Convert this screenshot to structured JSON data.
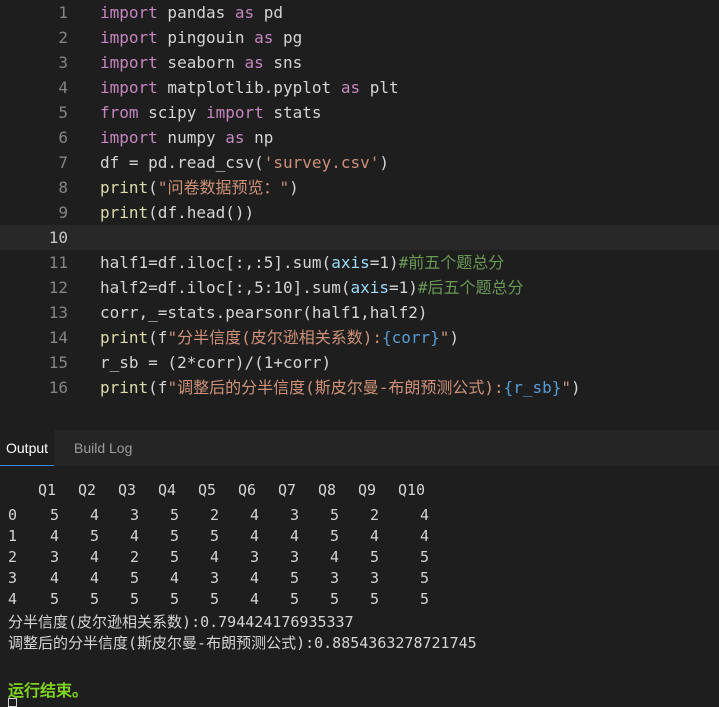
{
  "editor": {
    "lines": [
      {
        "n": "1",
        "tokens": [
          [
            "kw",
            "import"
          ],
          [
            "op",
            " pandas "
          ],
          [
            "kw",
            "as"
          ],
          [
            "op",
            " pd"
          ]
        ]
      },
      {
        "n": "2",
        "tokens": [
          [
            "kw",
            "import"
          ],
          [
            "op",
            " pingouin "
          ],
          [
            "kw",
            "as"
          ],
          [
            "op",
            " pg"
          ]
        ]
      },
      {
        "n": "3",
        "tokens": [
          [
            "kw",
            "import"
          ],
          [
            "op",
            " seaborn "
          ],
          [
            "kw",
            "as"
          ],
          [
            "op",
            " sns"
          ]
        ]
      },
      {
        "n": "4",
        "tokens": [
          [
            "kw",
            "import"
          ],
          [
            "op",
            " matplotlib.pyplot "
          ],
          [
            "kw",
            "as"
          ],
          [
            "op",
            " plt"
          ]
        ]
      },
      {
        "n": "5",
        "tokens": [
          [
            "kw",
            "from"
          ],
          [
            "op",
            " scipy "
          ],
          [
            "kw",
            "import"
          ],
          [
            "op",
            " stats"
          ]
        ]
      },
      {
        "n": "6",
        "tokens": [
          [
            "kw",
            "import"
          ],
          [
            "op",
            " numpy "
          ],
          [
            "kw",
            "as"
          ],
          [
            "op",
            " np"
          ]
        ]
      },
      {
        "n": "7",
        "tokens": [
          [
            "op",
            "df = pd.read_csv("
          ],
          [
            "str",
            "'survey.csv'"
          ],
          [
            "op",
            ")"
          ]
        ]
      },
      {
        "n": "8",
        "tokens": [
          [
            "fn",
            "print"
          ],
          [
            "op",
            "("
          ],
          [
            "str",
            "\"问卷数据预览：\""
          ],
          [
            "op",
            ")"
          ]
        ]
      },
      {
        "n": "9",
        "tokens": [
          [
            "fn",
            "print"
          ],
          [
            "op",
            "(df.head())"
          ]
        ]
      },
      {
        "n": "10",
        "tokens": [],
        "current": true
      },
      {
        "n": "11",
        "tokens": [
          [
            "op",
            "half1=df.iloc[:,:5].sum("
          ],
          [
            "pm",
            "axis"
          ],
          [
            "op",
            "=1)"
          ],
          [
            "cm",
            "#前五个题总分"
          ]
        ]
      },
      {
        "n": "12",
        "tokens": [
          [
            "op",
            "half2=df.iloc[:,5:10].sum("
          ],
          [
            "pm",
            "axis"
          ],
          [
            "op",
            "=1)"
          ],
          [
            "cm",
            "#后五个题总分"
          ]
        ]
      },
      {
        "n": "13",
        "tokens": [
          [
            "op",
            "corr,_=stats.pearsonr(half1,half2)"
          ]
        ]
      },
      {
        "n": "14",
        "tokens": [
          [
            "fn",
            "print"
          ],
          [
            "op",
            "(f"
          ],
          [
            "str",
            "\"分半信度(皮尔逊相关系数):"
          ],
          [
            "br",
            "{corr}"
          ],
          [
            "str",
            "\""
          ],
          [
            "op",
            ")"
          ]
        ]
      },
      {
        "n": "15",
        "tokens": [
          [
            "op",
            "r_sb = (2*corr)/(1+corr)"
          ]
        ]
      },
      {
        "n": "16",
        "tokens": [
          [
            "fn",
            "print"
          ],
          [
            "op",
            "(f"
          ],
          [
            "str",
            "\"调整后的分半信度(斯皮尔曼-布朗预测公式):"
          ],
          [
            "br",
            "{r_sb}"
          ],
          [
            "str",
            "\""
          ],
          [
            "op",
            ")"
          ]
        ]
      }
    ]
  },
  "tabs": [
    {
      "label": "Output",
      "active": true
    },
    {
      "label": "Build Log",
      "active": false
    }
  ],
  "output": {
    "table": {
      "columns": [
        "Q1",
        "Q2",
        "Q3",
        "Q4",
        "Q5",
        "Q6",
        "Q7",
        "Q8",
        "Q9",
        "Q10"
      ],
      "rows": [
        {
          "index": "0",
          "values": [
            "5",
            "4",
            "3",
            "5",
            "2",
            "4",
            "3",
            "5",
            "2",
            "4"
          ]
        },
        {
          "index": "1",
          "values": [
            "4",
            "5",
            "4",
            "5",
            "5",
            "4",
            "4",
            "5",
            "4",
            "4"
          ]
        },
        {
          "index": "2",
          "values": [
            "3",
            "4",
            "2",
            "5",
            "4",
            "3",
            "3",
            "4",
            "5",
            "5"
          ]
        },
        {
          "index": "3",
          "values": [
            "4",
            "4",
            "5",
            "4",
            "3",
            "4",
            "5",
            "3",
            "3",
            "5"
          ]
        },
        {
          "index": "4",
          "values": [
            "5",
            "5",
            "5",
            "5",
            "5",
            "4",
            "5",
            "5",
            "5",
            "5"
          ]
        }
      ]
    },
    "result1": "分半信度(皮尔逊相关系数):0.794424176935337",
    "result2": "调整后的分半信度(斯皮尔曼-布朗预测公式):0.8854363278721745",
    "status": "运行结束。"
  }
}
